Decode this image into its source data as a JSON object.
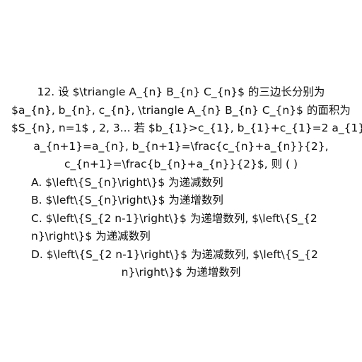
{
  "question": {
    "stem_lines": [
      "12.  设 $\\triangle A_{n} B_{n} C_{n}$ 的三边长分别为",
      "$a_{n}, b_{n}, c_{n}, \\triangle A_{n} B_{n} C_{n}$ 的面积为",
      "$S_{n}, n=1$ , 2, 3... 若 $b_{1}>c_{1}, b_{1}+c_{1}=2 a_{1},",
      "a_{n+1}=a_{n}, b_{n+1}=\\frac{c_{n}+a_{n}}{2},",
      "c_{n+1}=\\frac{b_{n}+a_{n}}{2}$, 则 ( )"
    ],
    "options": {
      "a": "A. $\\left\\{S_{n}\\right\\}$ 为递减数列",
      "b": "B. $\\left\\{S_{n}\\right\\}$ 为递增数列",
      "c_line1": "C. $\\left\\{S_{2 n-1}\\right\\}$ 为递增数列, $\\left\\{S_{2",
      "c_line2": "n}\\right\\}$ 为递减数列",
      "d_line1": "D. $\\left\\{S_{2 n-1}\\right\\}$ 为递减数列, $\\left\\{S_{2",
      "d_line2": "n}\\right\\}$ 为递增数列"
    }
  }
}
